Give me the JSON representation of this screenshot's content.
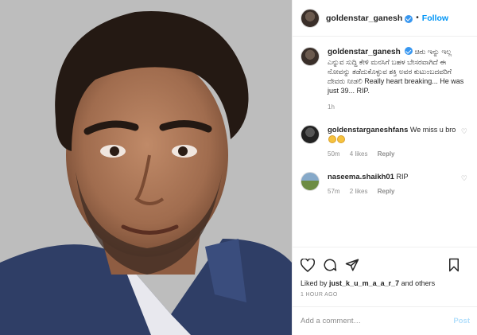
{
  "post": {
    "username": "goldenstar_ganesh",
    "follow_label": "Follow",
    "dot": "•"
  },
  "caption": {
    "username": "goldenstar_ganesh",
    "text": "ಚಿರು ಇನ್ನು ಇಲ್ಲ ಎನ್ನುವ ಸುದ್ದಿ ಕೇಳಿ ಮನಸಿಗೆ ಬಹಳ ಬೇಸರವಾಗಿದೆ ಈ ನೋವನ್ನು ತಡೆದುಕೊಳ್ಳುವ ಶಕ್ತಿ ಅವರ ಕುಟುಂಬದವರಿಗೆ ದೇವರು ನೀಡಲಿ Really heart breaking... He was just 39... RIP.",
    "time": "1h"
  },
  "comments": [
    {
      "username": "goldenstarganeshfans",
      "text": "We miss u bro",
      "time": "50m",
      "likes": "4 likes",
      "reply": "Reply"
    },
    {
      "username": "naseema.shaikh01",
      "text": "RIP",
      "time": "57m",
      "likes": "2 likes",
      "reply": "Reply"
    }
  ],
  "actions": {
    "liked_by_prefix": "Liked by",
    "liked_by_user": "just_k_u_m_a_a_r_7",
    "liked_by_suffix": "and others",
    "time_ago": "1 HOUR AGO"
  },
  "composer": {
    "placeholder": "Add a comment…",
    "post_label": "Post"
  },
  "colors": {
    "link_blue": "#0095f6",
    "verified_blue": "#3897f0",
    "muted_text": "#8e8e8e"
  }
}
